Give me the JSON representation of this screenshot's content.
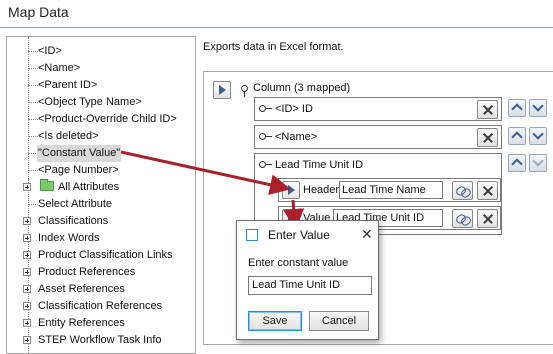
{
  "window": {
    "title": "Map Data"
  },
  "tree": {
    "items": [
      {
        "label": "<ID>",
        "type": "leaf"
      },
      {
        "label": "<Name>",
        "type": "leaf"
      },
      {
        "label": "<Parent ID>",
        "type": "leaf"
      },
      {
        "label": "<Object Type Name>",
        "type": "leaf"
      },
      {
        "label": "<Product-Override Child ID>",
        "type": "leaf"
      },
      {
        "label": "<Is deleted>",
        "type": "leaf"
      },
      {
        "label": "\"Constant Value\"",
        "type": "leaf",
        "selected": true
      },
      {
        "label": "<Page Number>",
        "type": "leaf"
      },
      {
        "label": "All Attributes",
        "type": "folder"
      },
      {
        "label": "Select Attribute",
        "type": "plain"
      },
      {
        "label": "Classifications",
        "type": "group"
      },
      {
        "label": "Index Words",
        "type": "group"
      },
      {
        "label": "Product Classification Links",
        "type": "group"
      },
      {
        "label": "Product References",
        "type": "group"
      },
      {
        "label": "Asset References",
        "type": "group"
      },
      {
        "label": "Classification References",
        "type": "group"
      },
      {
        "label": "Entity References",
        "type": "group"
      },
      {
        "label": "STEP Workflow Task Info",
        "type": "group"
      }
    ]
  },
  "main": {
    "description": "Exports data in Excel format.",
    "column_header": "Column (3 mapped)",
    "mappings": [
      {
        "label": "<ID> ID"
      },
      {
        "label": "<Name>"
      },
      {
        "label": "Lead Time Unit ID"
      }
    ],
    "sub_rows": [
      {
        "label": "Header",
        "value": "Lead Time Name"
      },
      {
        "label": "Value",
        "value": "Lead Time Unit ID"
      }
    ]
  },
  "dialog": {
    "title": "Enter Value",
    "close_glyph": "✕",
    "field_label": "Enter constant value",
    "field_value": "Lead Time Unit ID",
    "save_label": "Save",
    "cancel_label": "Cancel"
  },
  "colors": {
    "annotation_arrow": "#a8212b",
    "title_rule": "#8a9bb5",
    "accent_blue": "#2a8fd6"
  }
}
